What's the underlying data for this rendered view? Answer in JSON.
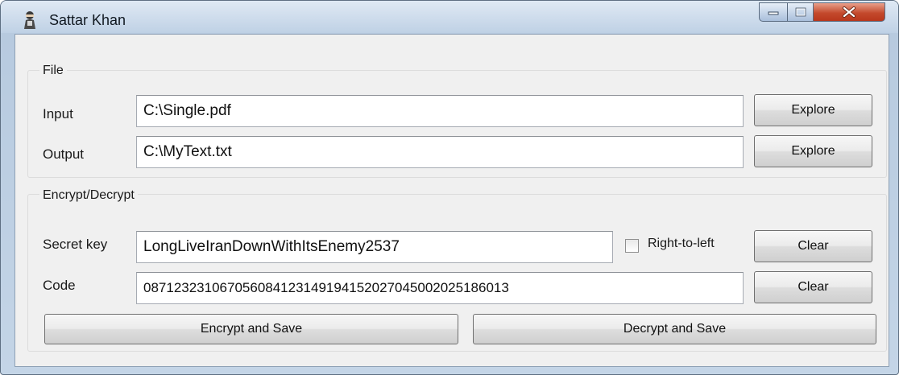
{
  "window": {
    "title": "Sattar Khan",
    "icon": "app-figure-icon"
  },
  "window_controls": {
    "minimize_icon": "minimize-icon",
    "maximize_icon": "maximize-icon",
    "close_icon": "close-icon"
  },
  "file_group": {
    "title": "File",
    "input_label": "Input",
    "input_value": "C:\\Single.pdf",
    "input_button": "Explore",
    "output_label": "Output",
    "output_value": "C:\\MyText.txt",
    "output_button": "Explore"
  },
  "encrypt_group": {
    "title": "Encrypt/Decrypt",
    "secret_label": "Secret key",
    "secret_value": "LongLiveIranDownWithItsEnemy2537",
    "rtl_label": "Right-to-left",
    "rtl_checked": false,
    "secret_clear": "Clear",
    "code_label": "Code",
    "code_value": "087123231067056084123149194152027045002025186013",
    "code_clear": "Clear",
    "encrypt_button": "Encrypt and Save",
    "decrypt_button": "Decrypt and Save"
  }
}
